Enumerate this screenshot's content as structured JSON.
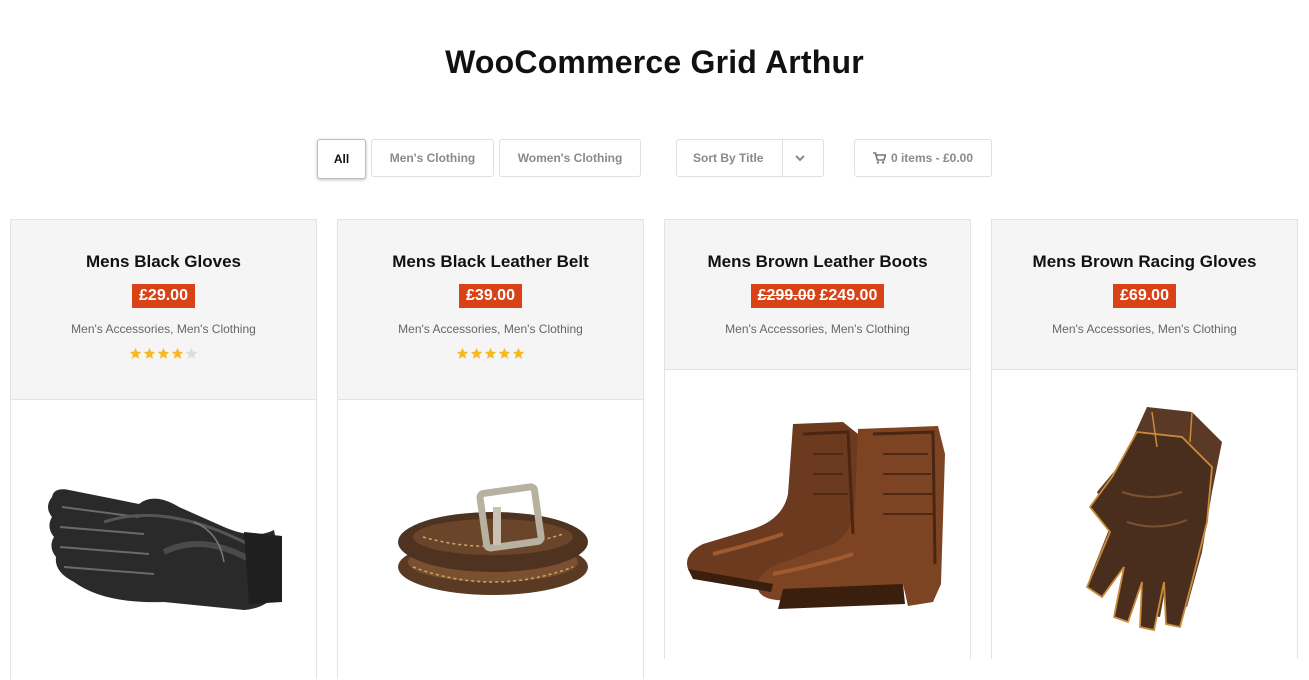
{
  "page": {
    "title": "WooCommerce Grid Arthur"
  },
  "filters": [
    {
      "label": "All",
      "active": true
    },
    {
      "label": "Men's Clothing",
      "active": false
    },
    {
      "label": "Women's Clothing",
      "active": false
    }
  ],
  "sort": {
    "label": "Sort By Title",
    "icon": "chevron-down-icon"
  },
  "cart": {
    "label": "0 items - £0.00",
    "icon": "cart-icon"
  },
  "colors": {
    "price_badge": "#d94216",
    "star_filled": "#f5b921",
    "star_empty": "#dcdcdc",
    "card_head_bg": "#f5f5f5"
  },
  "products": [
    {
      "title": "Mens Black Gloves",
      "price": "£29.00",
      "old_price": "",
      "categories": "Men's Accessories, Men's Clothing",
      "rating": 4,
      "image": "black-gloves-image"
    },
    {
      "title": "Mens Black Leather Belt",
      "price": "£39.00",
      "old_price": "",
      "categories": "Men's Accessories, Men's Clothing",
      "rating": 5,
      "image": "leather-belt-image"
    },
    {
      "title": "Mens Brown Leather Boots",
      "price": "£249.00",
      "old_price": "£299.00",
      "categories": "Men's Accessories, Men's Clothing",
      "rating": 0,
      "image": "leather-boots-image"
    },
    {
      "title": "Mens Brown Racing Gloves",
      "price": "£69.00",
      "old_price": "",
      "categories": "Men's Accessories, Men's Clothing",
      "rating": 0,
      "image": "racing-gloves-image"
    }
  ]
}
